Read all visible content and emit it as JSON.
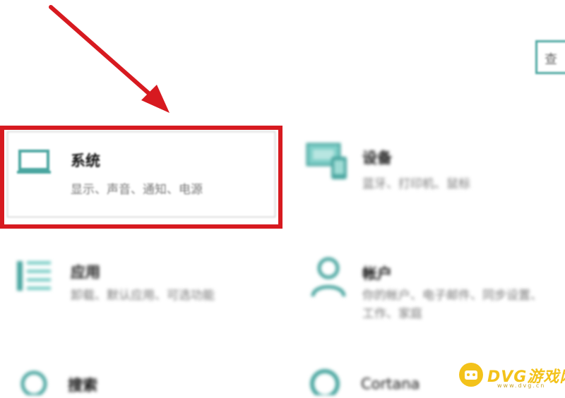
{
  "search": {
    "text": "查"
  },
  "tiles": {
    "system": {
      "title": "系统",
      "desc": "显示、声音、通知、电源"
    },
    "devices": {
      "title": "设备",
      "desc": "蓝牙、打印机、鼠标"
    },
    "apps": {
      "title": "应用",
      "desc": "卸载、默认应用、可选功能"
    },
    "accounts": {
      "title": "帐户",
      "desc": "你的帐户、电子邮件、同步设置、",
      "desc2": "工作、家庭"
    },
    "search": {
      "title": "搜索"
    },
    "cortana": {
      "title": "Cortana"
    }
  },
  "watermark": {
    "text": "DVG游戏网",
    "sub": "www.dvg.cn"
  },
  "colors": {
    "accent": "#4aa6a0",
    "highlight": "#d71a20",
    "arrow": "#d71a20",
    "watermark": "#f3c21a"
  }
}
